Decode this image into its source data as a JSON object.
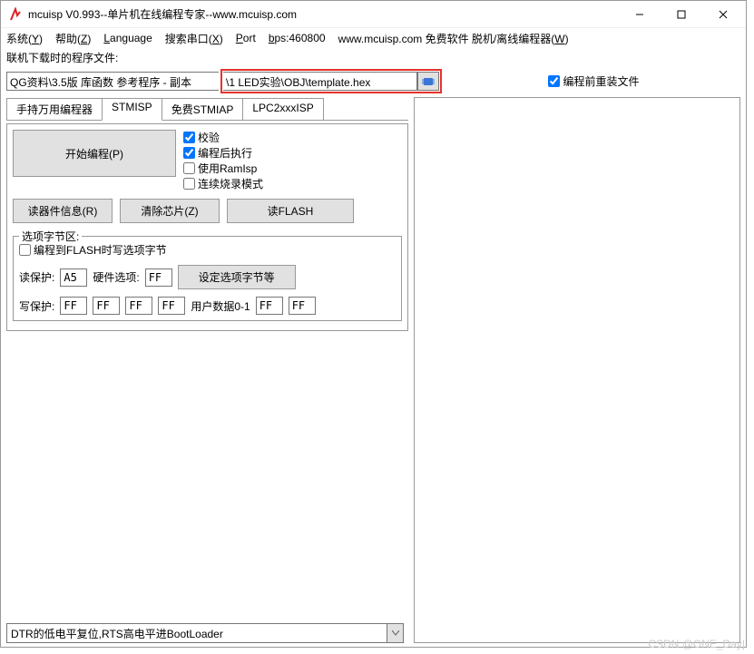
{
  "titlebar": {
    "title": "mcuisp V0.993--单片机在线编程专家--www.mcuisp.com"
  },
  "menu": {
    "system": "系统(Y)",
    "help": "帮助(Z)",
    "language": "Language",
    "search": "搜索串口(X)",
    "port": "Port",
    "bps": "bps:460800",
    "site": "www.mcuisp.com 免费软件 脱机/离线编程器(W)"
  },
  "filelabel": "联机下载时的程序文件:",
  "filepath_left": "QG资料\\3.5版 库函数 参考程序 - 副本",
  "filepath_right": "\\1 LED实验\\OBJ\\template.hex",
  "reload_label": "编程前重装文件",
  "tabs": {
    "t1": "手持万用编程器",
    "t2": "STMISP",
    "t3": "免费STMIAP",
    "t4": "LPC2xxxISP"
  },
  "buttons": {
    "start": "开始编程(P)",
    "readinfo": "读器件信息(R)",
    "erase": "清除芯片(Z)",
    "readflash": "读FLASH",
    "setoption": "设定选项字节等"
  },
  "opts": {
    "verify": "校验",
    "runafter": "编程后执行",
    "ramisp": "使用RamIsp",
    "contburn": "连续烧录模式"
  },
  "group": {
    "legend": "选项字节区:",
    "writeopt": "编程到FLASH时写选项字节",
    "readprotect": "读保护:",
    "hwopt": "硬件选项:",
    "writeprotect": "写保护:",
    "userdata": "用户数据0-1",
    "v_a5": "A5",
    "v_ff": "FF"
  },
  "combo": {
    "value": "DTR的低电平复位,RTS高电平进BootLoader"
  },
  "watermark": "CSDN @ONE_Day|"
}
